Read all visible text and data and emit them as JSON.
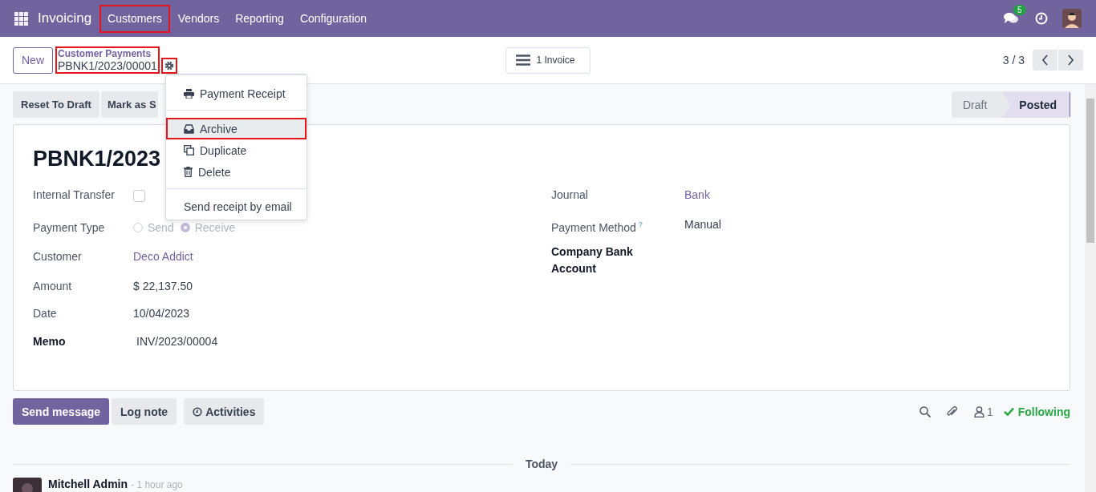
{
  "navbar": {
    "app": "Invoicing",
    "menus": [
      {
        "label": "Customers",
        "highlighted": true
      },
      {
        "label": "Vendors",
        "highlighted": false
      },
      {
        "label": "Reporting",
        "highlighted": false
      },
      {
        "label": "Configuration",
        "highlighted": false
      }
    ],
    "messages_badge": "5"
  },
  "control_panel": {
    "new_button": "New",
    "breadcrumb": {
      "parent": "Customer Payments",
      "current": "PBNK1/2023/00001",
      "highlighted": true
    },
    "gear_highlighted": true,
    "smart_button": "1 Invoice",
    "pager": "3 / 3"
  },
  "action_menu": {
    "groups": [
      [
        {
          "kind": "print",
          "label": "Payment Receipt",
          "highlighted": false
        }
      ],
      [
        {
          "kind": "archive",
          "label": "Archive",
          "highlighted": true
        },
        {
          "kind": "duplicate",
          "label": "Duplicate",
          "highlighted": false
        },
        {
          "kind": "delete",
          "label": "Delete",
          "highlighted": false
        }
      ],
      [
        {
          "kind": "text",
          "label": "Send receipt by email",
          "highlighted": false
        }
      ]
    ]
  },
  "status_buttons": [
    "Reset To Draft",
    "Mark as S"
  ],
  "statusbar": [
    {
      "label": "Draft",
      "selected": false
    },
    {
      "label": "Posted",
      "selected": true
    }
  ],
  "form": {
    "title": "PBNK1/2023",
    "left": [
      {
        "kind": "checkbox",
        "label": "Internal Transfer",
        "checked": false
      },
      {
        "kind": "radio",
        "label": "Payment Type",
        "options": [
          {
            "label": "Send",
            "selected": false
          },
          {
            "label": "Receive",
            "selected": true
          }
        ]
      },
      {
        "kind": "link",
        "label": "Customer",
        "value": "Deco Addict"
      },
      {
        "kind": "text",
        "label": "Amount",
        "value": "$ 22,137.50"
      },
      {
        "kind": "text",
        "label": "Date",
        "value": "10/04/2023"
      },
      {
        "kind": "text",
        "label": "Memo",
        "value": "INV/2023/00004",
        "required": true
      }
    ],
    "right": [
      {
        "kind": "link",
        "label": "Journal",
        "value": "Bank"
      },
      {
        "kind": "text",
        "label": "Payment Method",
        "value": "Manual",
        "help": "?"
      },
      {
        "kind": "empty",
        "label": "Company Bank Account",
        "required": true
      }
    ]
  },
  "chatter": {
    "buttons": [
      {
        "kind": "primary",
        "label": "Send message"
      },
      {
        "kind": "secondary",
        "label": "Log note"
      },
      {
        "kind": "activities",
        "label": "Activities"
      }
    ],
    "followers": "1",
    "follow_label": "Following",
    "divider": "Today",
    "message": {
      "author": "Mitchell Admin",
      "time": "- 1 hour ago"
    }
  }
}
